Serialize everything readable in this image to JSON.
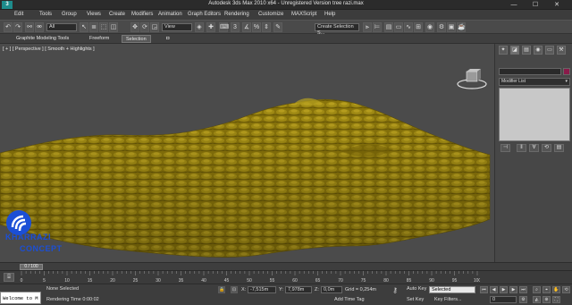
{
  "window": {
    "title": "Autodesk 3ds Max 2010 x64 - Unregistered Version   tree razi.max",
    "logo": "3",
    "minimize": "—",
    "maximize": "☐",
    "close": "✕"
  },
  "menu": {
    "items": [
      "Edit",
      "Tools",
      "Group",
      "Views",
      "Create",
      "Modifiers",
      "Animation",
      "Graph Editors",
      "Rendering",
      "Customize",
      "MAXScript",
      "Help"
    ]
  },
  "toolbar": {
    "selection_filter": "All",
    "reference_coord": "View",
    "named_selection": "Create Selection S..."
  },
  "ribbon": {
    "tabs": [
      "Graphite Modeling Tools",
      "Freeform",
      "Selection"
    ],
    "active_tab": "Selection",
    "toggle": "◘"
  },
  "viewport": {
    "label": "[ + ] [ Perspective ] [ Smooth + Highlights ]",
    "watermark_line1": "KHARRAZI",
    "watermark_line2": "CONCEPT",
    "terrain_color": "#8f7a0a"
  },
  "command_panel": {
    "tabs": [
      "✦",
      "◪",
      "▤",
      "◉",
      "▭",
      "⚒"
    ],
    "modifier_list": "Modifier List",
    "stack_buttons": [
      "⊣",
      "‖",
      "∀",
      "⟲",
      "▤"
    ],
    "object_color": "#8a1b4a"
  },
  "timeline": {
    "slider_label": "0 / 100",
    "current_frame": 0,
    "total_frames": 100,
    "ticks": [
      "0",
      "5",
      "10",
      "15",
      "20",
      "25",
      "30",
      "35",
      "40",
      "45",
      "50",
      "55",
      "60",
      "65",
      "70",
      "75",
      "80",
      "85",
      "90",
      "95",
      "100"
    ]
  },
  "status": {
    "maxscript": "Welcome to M",
    "prompt": "None Selected",
    "render_time": "Rendering Time  0:00:02",
    "x_label": "X:",
    "x_value": "-7,515m",
    "y_label": "Y:",
    "y_value": "7,978m",
    "z_label": "Z:",
    "z_value": "0,0m",
    "grid": "Grid = 0,254m",
    "add_time_tag": "Add Time Tag",
    "auto_key": "Auto Key",
    "set_key": "Set Key",
    "selection_dropdown": "Selected",
    "key_filters": "Key Filters...",
    "frame_value": "0"
  }
}
